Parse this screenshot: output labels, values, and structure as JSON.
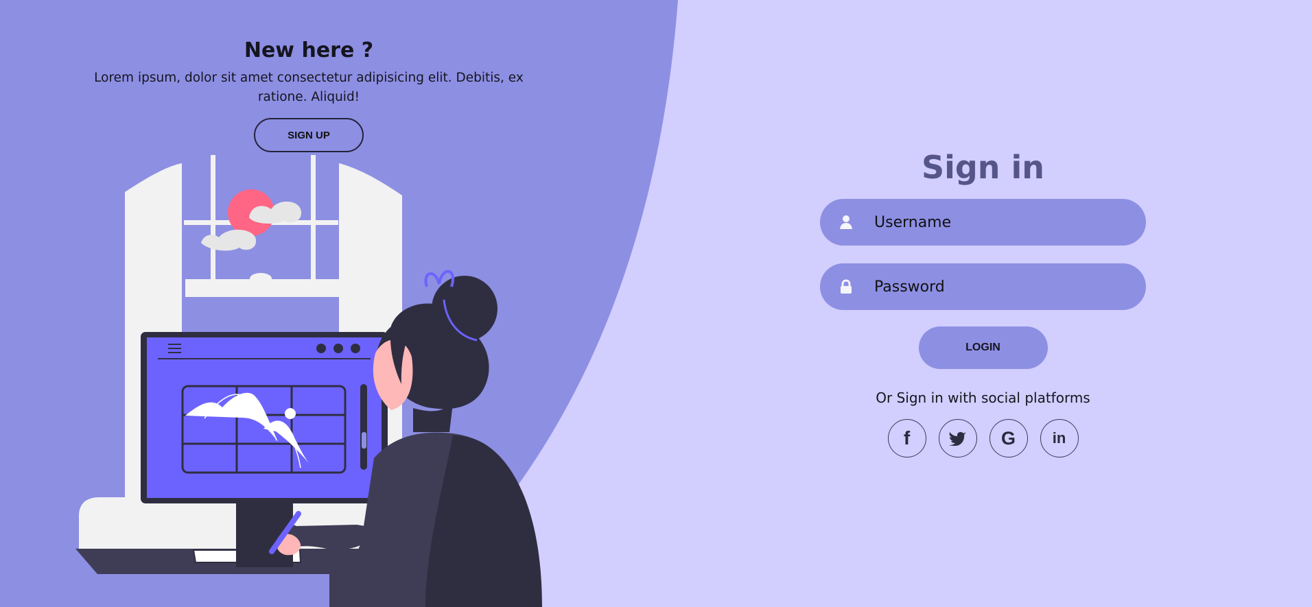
{
  "left_panel": {
    "title": "New here ?",
    "description": "Lorem ipsum, dolor sit amet consectetur adipisicing elit. Debitis, ex ratione. Aliquid!",
    "signup_label": "SIGN UP"
  },
  "signin": {
    "title": "Sign in",
    "username_placeholder": "Username",
    "password_placeholder": "Password",
    "login_label": "LOGIN",
    "social_text": "Or Sign in with social platforms",
    "social": [
      {
        "label": "f",
        "icon": "facebook-icon"
      },
      {
        "label": "",
        "icon": "twitter-icon"
      },
      {
        "label": "G",
        "icon": "google-icon"
      },
      {
        "label": "in",
        "icon": "linkedin-icon"
      }
    ]
  },
  "colors": {
    "background": "#d2cefd",
    "left_shape": "#8d8fe3",
    "field": "#8d8fe3",
    "title": "#555589",
    "accent": "#6c63ff",
    "dark": "#2f2e41"
  }
}
